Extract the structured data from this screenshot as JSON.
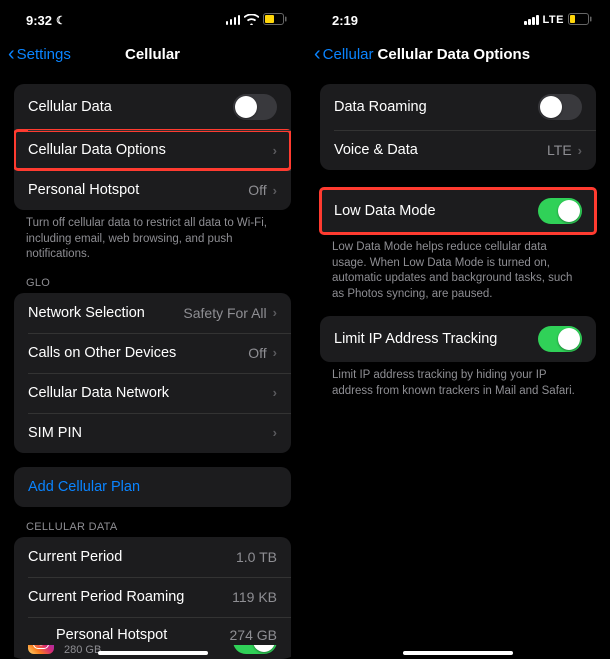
{
  "left": {
    "status": {
      "time": "9:32",
      "label_lte": ""
    },
    "nav": {
      "back": "Settings",
      "title": "Cellular"
    },
    "group1": {
      "cellular_data": "Cellular Data",
      "cellular_data_options": "Cellular Data Options",
      "personal_hotspot": "Personal Hotspot",
      "personal_hotspot_value": "Off"
    },
    "footer1": "Turn off cellular data to restrict all data to Wi-Fi, including email, web browsing, and push notifications.",
    "header_glo": "GLO",
    "group2": {
      "network_selection": "Network Selection",
      "network_selection_value": "Safety For All",
      "calls_other": "Calls on Other Devices",
      "calls_other_value": "Off",
      "cdn": "Cellular Data Network",
      "sim_pin": "SIM PIN"
    },
    "add_plan": "Add Cellular Plan",
    "header_cd": "CELLULAR DATA",
    "group3": {
      "current_period": "Current Period",
      "current_period_value": "1.0 TB",
      "current_period_roaming": "Current Period Roaming",
      "current_period_roaming_value": "119 KB",
      "app_name": "Instagram",
      "app_sub": "280 GB",
      "partial_label": "Personal Hotspot",
      "partial_value": "274 GB"
    }
  },
  "right": {
    "status": {
      "time": "2:19",
      "label_lte": "LTE"
    },
    "nav": {
      "back": "Cellular",
      "title": "Cellular Data Options"
    },
    "group1": {
      "data_roaming": "Data Roaming",
      "voice_data": "Voice & Data",
      "voice_data_value": "LTE"
    },
    "low_data": "Low Data Mode",
    "footer_low": "Low Data Mode helps reduce cellular data usage. When Low Data Mode is turned on, automatic updates and background tasks, such as Photos syncing, are paused.",
    "limit_ip": "Limit IP Address Tracking",
    "footer_ip": "Limit IP address tracking by hiding your IP address from known trackers in Mail and Safari."
  }
}
